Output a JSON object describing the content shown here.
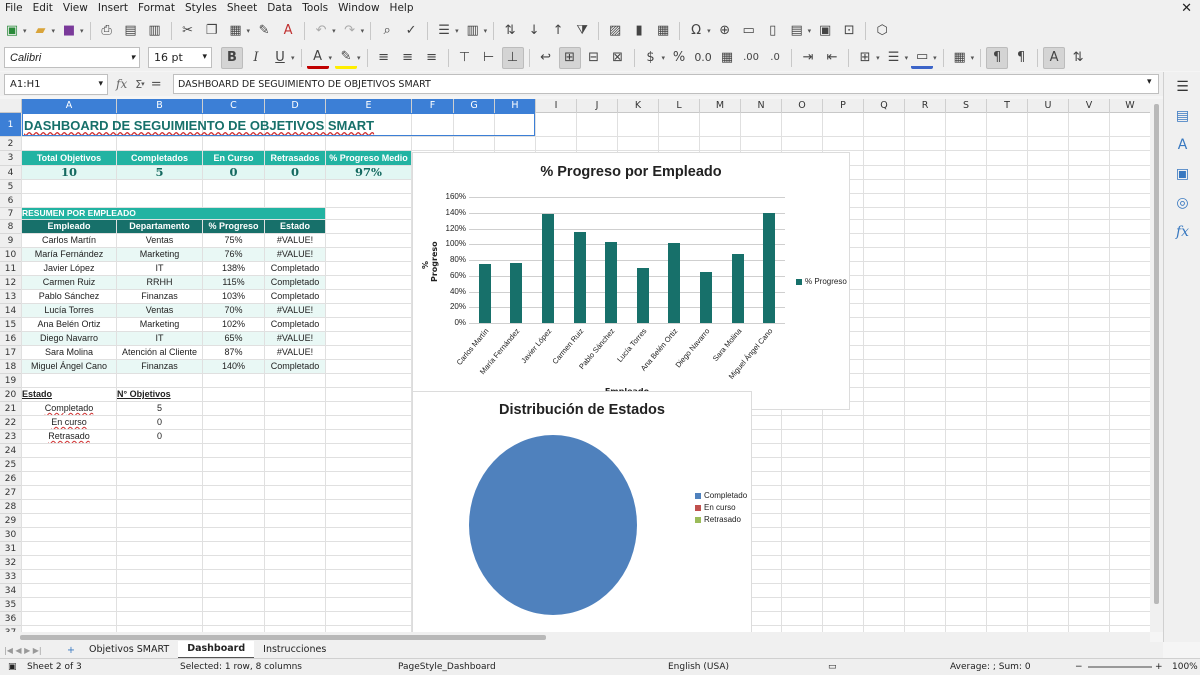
{
  "menu": [
    "File",
    "Edit",
    "View",
    "Insert",
    "Format",
    "Styles",
    "Sheet",
    "Data",
    "Tools",
    "Window",
    "Help"
  ],
  "font": {
    "name": "Calibri",
    "size": "16 pt"
  },
  "namebox": "A1:H1",
  "formula": "DASHBOARD DE SEGUIMIENTO DE OBJETIVOS SMART",
  "columns": [
    "A",
    "B",
    "C",
    "D",
    "E",
    "F",
    "G",
    "H",
    "I",
    "J",
    "K",
    "L",
    "M",
    "N",
    "O",
    "P",
    "Q",
    "R",
    "S",
    "T",
    "U",
    "V",
    "W"
  ],
  "rows": [
    "1",
    "2",
    "3",
    "4",
    "5",
    "6",
    "7",
    "8",
    "9",
    "10",
    "11",
    "12",
    "13",
    "14",
    "15",
    "16",
    "17",
    "18",
    "19",
    "20",
    "21",
    "22",
    "23",
    "24",
    "25",
    "26",
    "27",
    "28",
    "29",
    "30",
    "31",
    "32",
    "33",
    "34",
    "35",
    "36",
    "37"
  ],
  "sheet": {
    "title": "DASHBOARD DE SEGUIMIENTO DE OBJETIVOS SMART",
    "kpi_headers": [
      "Total Objetivos",
      "Completados",
      "En Curso",
      "Retrasados",
      "% Progreso Medio"
    ],
    "kpi_values": [
      "10",
      "5",
      "0",
      "0",
      "97%"
    ],
    "summary_title": "RESUMEN POR EMPLEADO",
    "table_headers": [
      "Empleado",
      "Departamento",
      "% Progreso",
      "Estado"
    ],
    "employees": [
      [
        "Carlos Martín",
        "Ventas",
        "75%",
        "#VALUE!"
      ],
      [
        "María Fernández",
        "Marketing",
        "76%",
        "#VALUE!"
      ],
      [
        "Javier López",
        "IT",
        "138%",
        "Completado"
      ],
      [
        "Carmen Ruiz",
        "RRHH",
        "115%",
        "Completado"
      ],
      [
        "Pablo Sánchez",
        "Finanzas",
        "103%",
        "Completado"
      ],
      [
        "Lucía Torres",
        "Ventas",
        "70%",
        "#VALUE!"
      ],
      [
        "Ana Belén Ortiz",
        "Marketing",
        "102%",
        "Completado"
      ],
      [
        "Diego Navarro",
        "IT",
        "65%",
        "#VALUE!"
      ],
      [
        "Sara Molina",
        "Atención al Cliente",
        "87%",
        "#VALUE!"
      ],
      [
        "Miguel Ángel Cano",
        "Finanzas",
        "140%",
        "Completado"
      ]
    ],
    "status_header": [
      "Estado",
      "N° Objetivos"
    ],
    "status_rows": [
      [
        "Completado",
        "5"
      ],
      [
        "En curso",
        "0"
      ],
      [
        "Retrasado",
        "0"
      ]
    ]
  },
  "chart_data": [
    {
      "type": "bar",
      "title": "% Progreso por Empleado",
      "ylabel": "% Progreso",
      "xlabel": "Empleado",
      "categories": [
        "Carlos Martín",
        "María Fernández",
        "Javier López",
        "Carmen Ruiz",
        "Pablo Sánchez",
        "Lucía Torres",
        "Ana Belén Ortiz",
        "Diego Navarro",
        "Sara Molina",
        "Miguel Ángel Cano"
      ],
      "series": [
        {
          "name": "% Progreso",
          "values": [
            0.75,
            0.76,
            1.38,
            1.15,
            1.03,
            0.7,
            1.02,
            0.65,
            0.87,
            1.4
          ]
        }
      ],
      "yticks": [
        "0%",
        "20%",
        "40%",
        "60%",
        "80%",
        "100%",
        "120%",
        "140%",
        "160%"
      ],
      "ylim": [
        0,
        1.6
      ],
      "grid": true,
      "legend": "right",
      "color": "#17706a"
    },
    {
      "type": "pie",
      "title": "Distribución de Estados",
      "categories": [
        "Completado",
        "En curso",
        "Retrasado"
      ],
      "values": [
        5,
        0,
        0
      ],
      "colors": [
        "#4f81bd",
        "#c0504d",
        "#9bbb59"
      ],
      "legend": "right"
    }
  ],
  "tabs": [
    "Objetivos SMART",
    "Dashboard",
    "Instrucciones"
  ],
  "status": {
    "sheet": "Sheet 2 of 3",
    "selected": "Selected: 1 row, 8 columns",
    "style": "PageStyle_Dashboard",
    "lang": "English (USA)",
    "sum": "Average: ; Sum: 0",
    "zoom": "100%"
  }
}
